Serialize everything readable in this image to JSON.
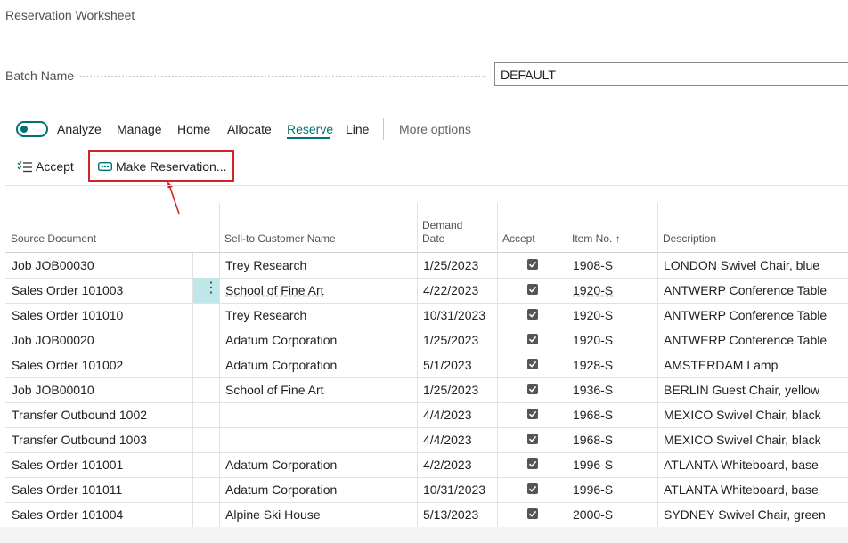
{
  "page": {
    "title": "Reservation Worksheet"
  },
  "batch": {
    "label": "Batch Name",
    "value": "DEFAULT"
  },
  "tabs": {
    "analyze": "Analyze",
    "manage": "Manage",
    "home": "Home",
    "allocate": "Allocate",
    "reserve": "Reserve",
    "line": "Line",
    "more": "More options"
  },
  "actions": {
    "accept": "Accept",
    "make_reservation": "Make Reservation..."
  },
  "colors": {
    "accent": "#00726f",
    "highlight": "#d2232a",
    "selected_cell": "#bfe7ea"
  },
  "grid": {
    "headers": {
      "source_document": "Source Document",
      "customer": "Sell-to Customer Name",
      "demand_line1": "Demand",
      "demand_line2": "Date",
      "accept": "Accept",
      "item_no": "Item No.",
      "sort_indicator": "↑",
      "description": "Description"
    },
    "rows": [
      {
        "source": "Job JOB00030",
        "customer": "Trey Research",
        "date": "1/25/2023",
        "accept": true,
        "item": "1908-S",
        "description": "LONDON Swivel Chair, blue"
      },
      {
        "source": "Sales Order 101003",
        "customer": "School of Fine Art",
        "date": "4/22/2023",
        "accept": true,
        "item": "1920-S",
        "description": "ANTWERP Conference Table"
      },
      {
        "source": "Sales Order 101010",
        "customer": "Trey Research",
        "date": "10/31/2023",
        "accept": true,
        "item": "1920-S",
        "description": "ANTWERP Conference Table"
      },
      {
        "source": "Job JOB00020",
        "customer": "Adatum Corporation",
        "date": "1/25/2023",
        "accept": true,
        "item": "1920-S",
        "description": "ANTWERP Conference Table"
      },
      {
        "source": "Sales Order 101002",
        "customer": "Adatum Corporation",
        "date": "5/1/2023",
        "accept": true,
        "item": "1928-S",
        "description": "AMSTERDAM Lamp"
      },
      {
        "source": "Job JOB00010",
        "customer": "School of Fine Art",
        "date": "1/25/2023",
        "accept": true,
        "item": "1936-S",
        "description": "BERLIN Guest Chair, yellow"
      },
      {
        "source": "Transfer Outbound 1002",
        "customer": "",
        "date": "4/4/2023",
        "accept": true,
        "item": "1968-S",
        "description": "MEXICO Swivel Chair, black"
      },
      {
        "source": "Transfer Outbound 1003",
        "customer": "",
        "date": "4/4/2023",
        "accept": true,
        "item": "1968-S",
        "description": "MEXICO Swivel Chair, black"
      },
      {
        "source": "Sales Order 101001",
        "customer": "Adatum Corporation",
        "date": "4/2/2023",
        "accept": true,
        "item": "1996-S",
        "description": "ATLANTA Whiteboard, base"
      },
      {
        "source": "Sales Order 101011",
        "customer": "Adatum Corporation",
        "date": "10/31/2023",
        "accept": true,
        "item": "1996-S",
        "description": "ATLANTA Whiteboard, base"
      },
      {
        "source": "Sales Order 101004",
        "customer": "Alpine Ski House",
        "date": "5/13/2023",
        "accept": true,
        "item": "2000-S",
        "description": "SYDNEY Swivel Chair, green"
      }
    ]
  }
}
